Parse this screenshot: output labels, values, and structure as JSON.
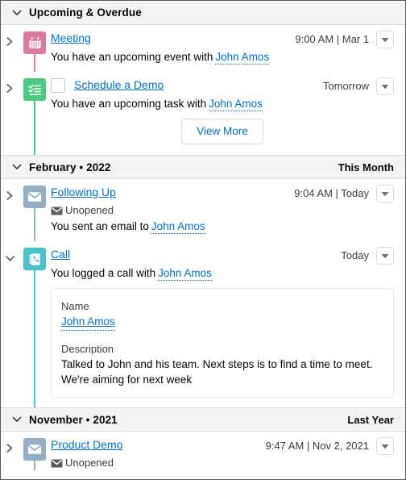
{
  "sections": [
    {
      "id": "upcoming",
      "title": "Upcoming & Overdue",
      "right_label": "",
      "expanded": true
    },
    {
      "id": "february",
      "title": "February • 2022",
      "right_label": "This Month",
      "expanded": true
    },
    {
      "id": "november",
      "title": "November • 2021",
      "right_label": "Last Year",
      "expanded": true
    }
  ],
  "items": {
    "meeting": {
      "title": "Meeting",
      "icon": "calendar-icon",
      "icon_color": "#dd7a9f",
      "line_color": "#dd7a9f",
      "timestamp": "9:00 AM | Mar 1",
      "sub_prefix": "You have an upcoming event with",
      "related_name": "John Amos",
      "toggle": "chevron-right-icon"
    },
    "task": {
      "title": "Schedule a Demo",
      "icon": "task-checklist-icon",
      "icon_color": "#4bca81",
      "line_color": "#4bca81",
      "timestamp": "Tomorrow",
      "sub_prefix": "You have an upcoming task with",
      "related_name": "John Amos",
      "toggle": "chevron-right-icon",
      "has_checkbox": true
    },
    "email": {
      "title": "Following Up",
      "icon": "email-icon",
      "icon_color": "#95aec4",
      "line_color": "#95aec4",
      "timestamp": "9:04 AM | Today",
      "status": "Unopened",
      "sub_prefix": "You sent an email to",
      "related_name": "John Amos",
      "toggle": "chevron-right-icon"
    },
    "call": {
      "title": "Call",
      "icon": "call-log-icon",
      "icon_color": "#48c3cc",
      "line_color": "#48c3cc",
      "timestamp": "Today",
      "sub_prefix": "You logged a call with",
      "related_name": "John Amos",
      "toggle": "chevron-down-icon",
      "details": {
        "name_label": "Name",
        "name_value": "John Amos",
        "description_label": "Description",
        "description_value": "Talked to John and his team. Next steps is to find a time to meet. We're aiming for next week"
      }
    },
    "product_demo": {
      "title": "Product Demo",
      "icon": "email-icon",
      "icon_color": "#95aec4",
      "line_color": "#95aec4",
      "timestamp": "9:47 AM | Nov 2, 2021",
      "status": "Unopened",
      "toggle": "chevron-right-icon"
    }
  },
  "buttons": {
    "view_more": "View More"
  },
  "colors": {
    "link": "#0070d2",
    "header_bg": "#f3f3f3",
    "text": "#080707"
  }
}
